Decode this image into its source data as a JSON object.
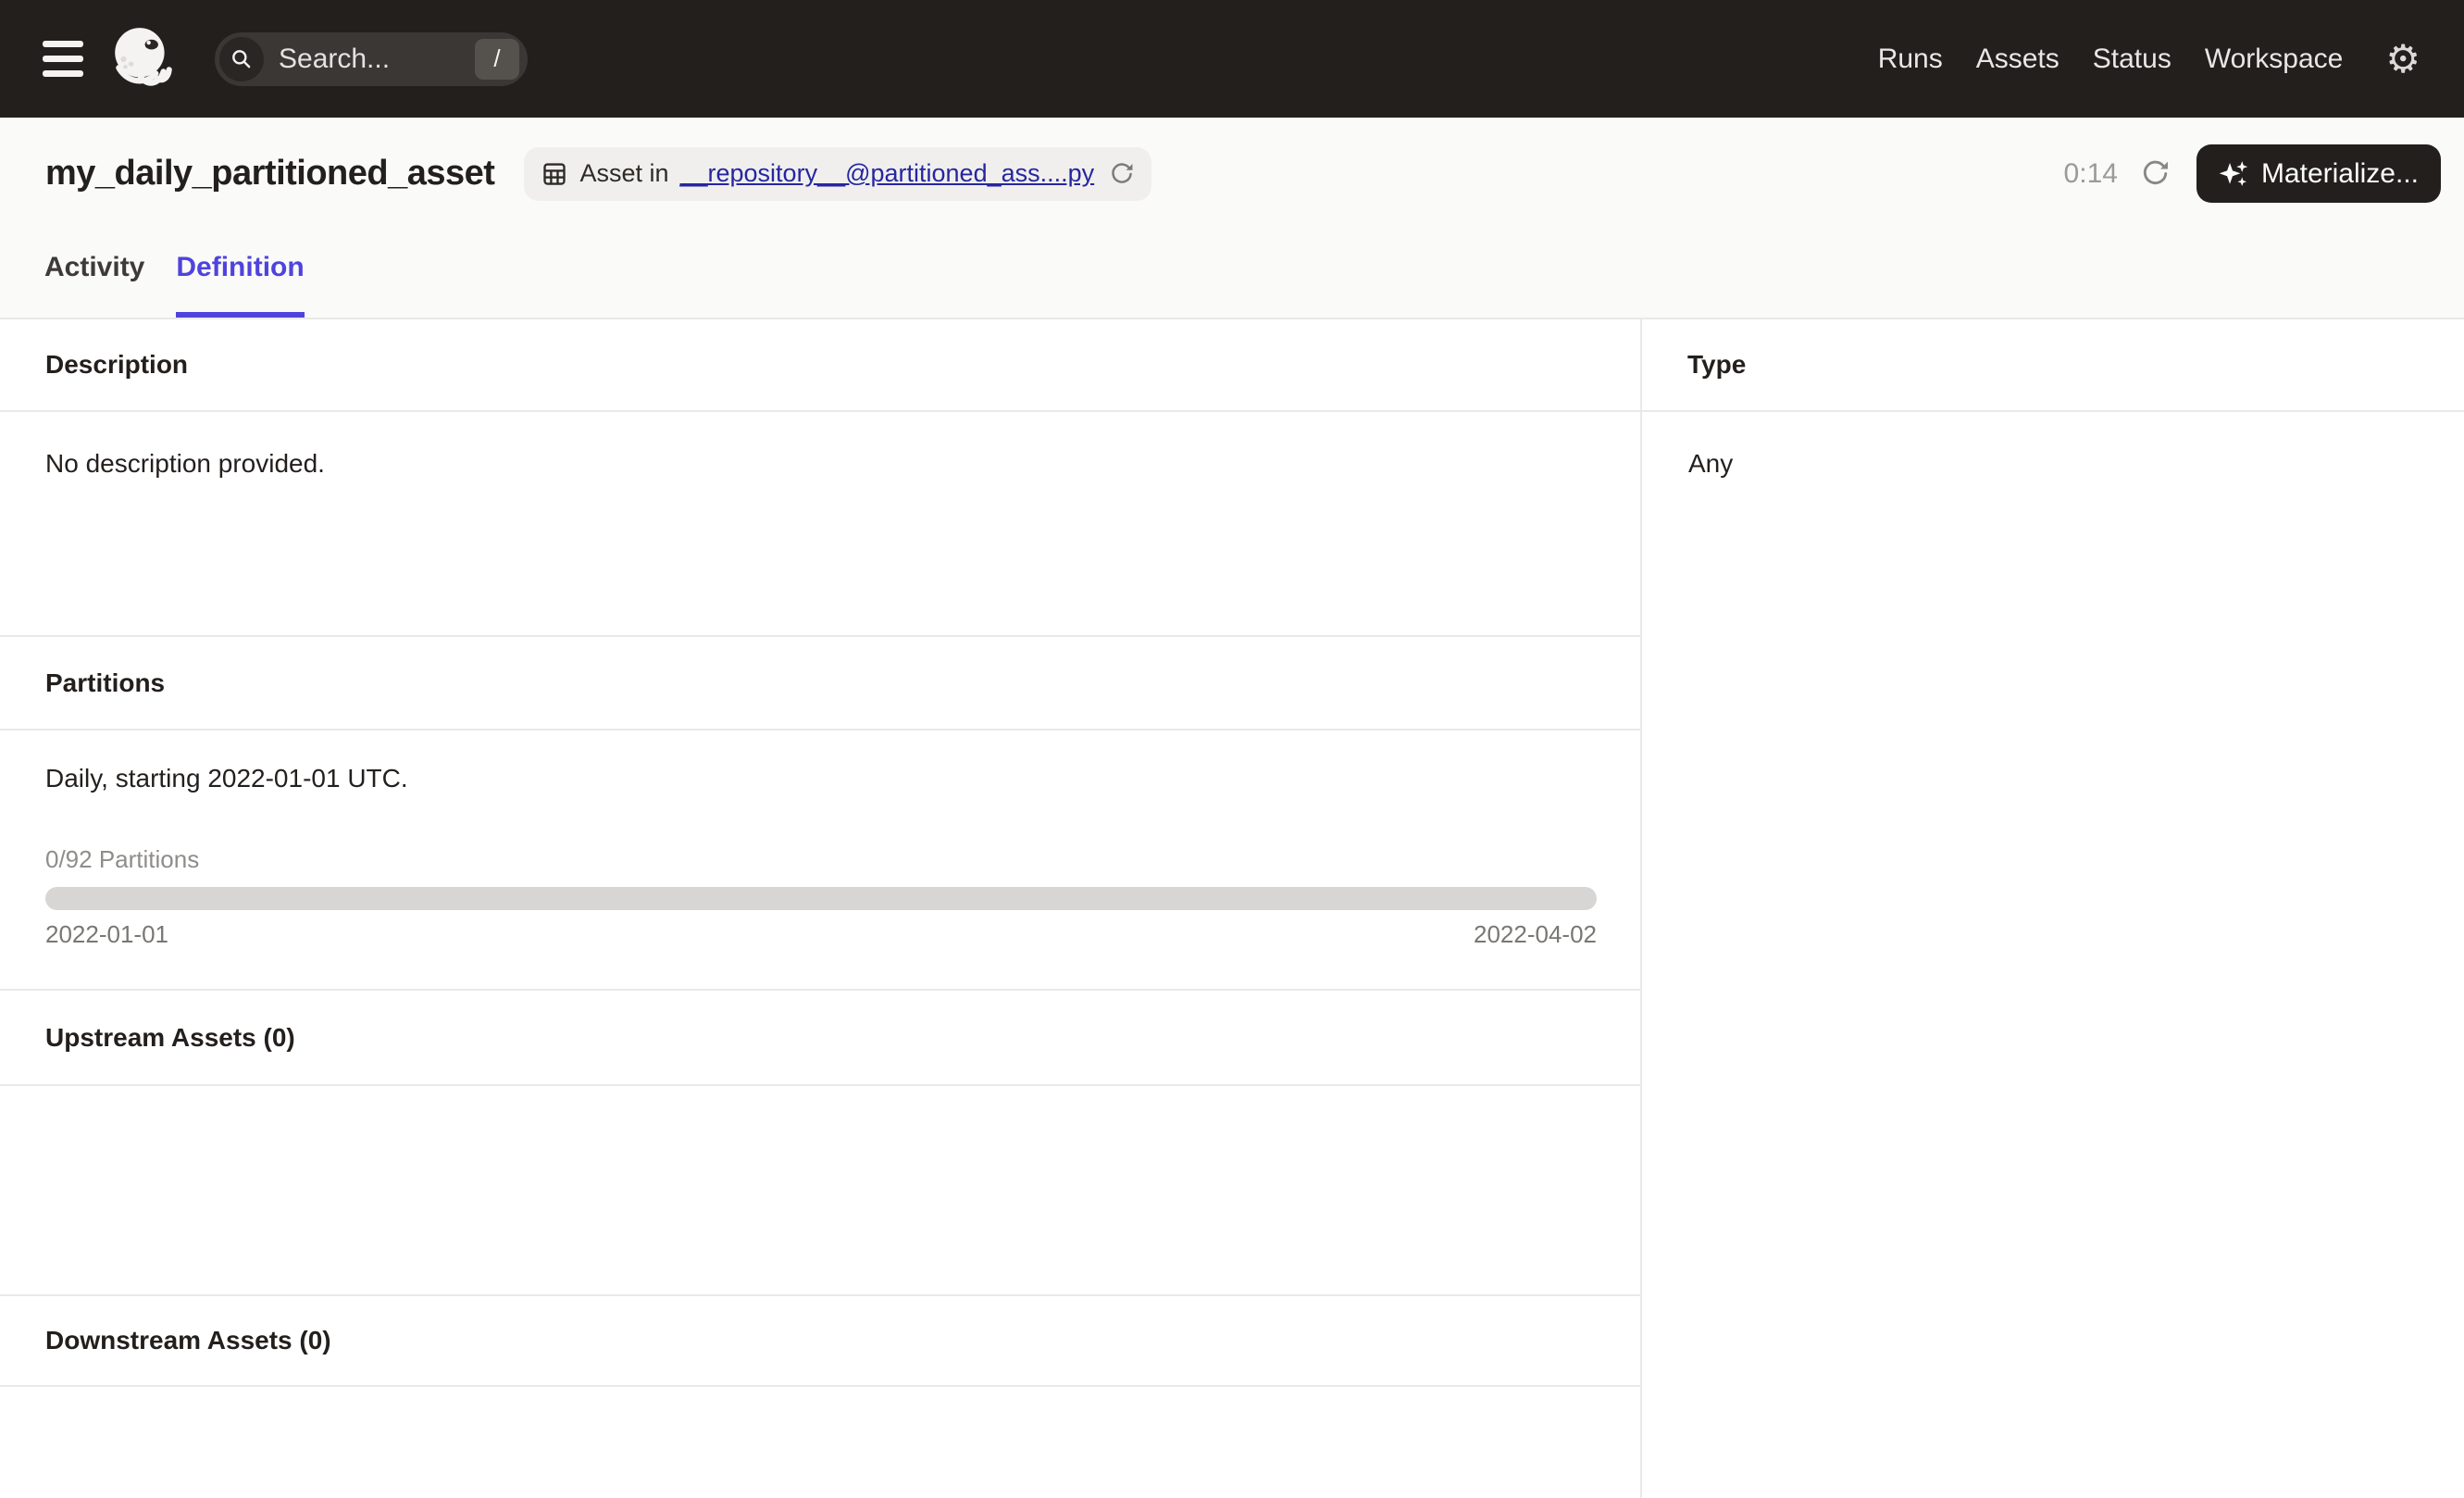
{
  "nav": {
    "search_placeholder": "Search...",
    "search_shortcut": "/",
    "links": [
      {
        "label": "Runs"
      },
      {
        "label": "Assets"
      },
      {
        "label": "Status"
      },
      {
        "label": "Workspace"
      }
    ],
    "gear_glyph": "⚙"
  },
  "header": {
    "title": "my_daily_partitioned_asset",
    "badge": {
      "prefix": "Asset in",
      "link": "__repository__@partitioned_ass....py"
    },
    "timer": "0:14",
    "materialize_label": "Materialize..."
  },
  "tabs": [
    {
      "label": "Activity",
      "active": false
    },
    {
      "label": "Definition",
      "active": true
    }
  ],
  "sections": {
    "description": {
      "heading": "Description",
      "body": "No description provided."
    },
    "partitions": {
      "heading": "Partitions",
      "summary": "Daily, starting 2022-01-01 UTC.",
      "progress_label": "0/92 Partitions",
      "progress_percent": 0,
      "range_start": "2022-01-01",
      "range_end": "2022-04-02"
    },
    "upstream": {
      "heading": "Upstream Assets (0)"
    },
    "downstream": {
      "heading": "Downstream Assets (0)"
    },
    "type": {
      "heading": "Type",
      "value": "Any"
    }
  },
  "colors": {
    "nav_bg": "#231F1D",
    "header_bg": "#FAFAF9",
    "accent_tab": "#4F43DD",
    "link": "#2626A0",
    "border": "#EAE9E7",
    "muted_text": "#8F8D8A",
    "progress_track": "#D8D6D4"
  }
}
